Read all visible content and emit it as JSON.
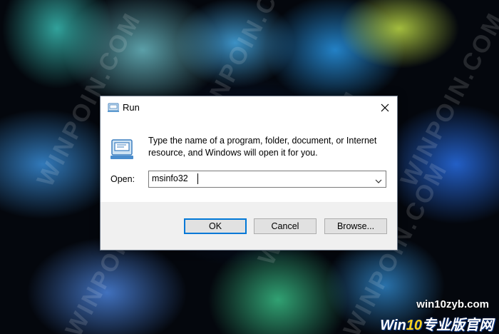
{
  "watermark": {
    "text": "WINPOIN.COM",
    "site": "win10zyb.com",
    "logo_prefix": "Win",
    "logo_number": "10",
    "logo_suffix": "专业版官网"
  },
  "dialog": {
    "title": "Run",
    "description": "Type the name of a program, folder, document, or Internet resource, and Windows will open it for you.",
    "open_label": "Open:",
    "open_value": "msinfo32",
    "buttons": {
      "ok": "OK",
      "cancel": "Cancel",
      "browse": "Browse..."
    }
  },
  "icons": [
    "run-icon",
    "close-icon",
    "chevron-down-icon"
  ],
  "colors": {
    "accent": "#0078d7",
    "dialog_bg": "#f0f0f0",
    "content_bg": "#ffffff"
  }
}
